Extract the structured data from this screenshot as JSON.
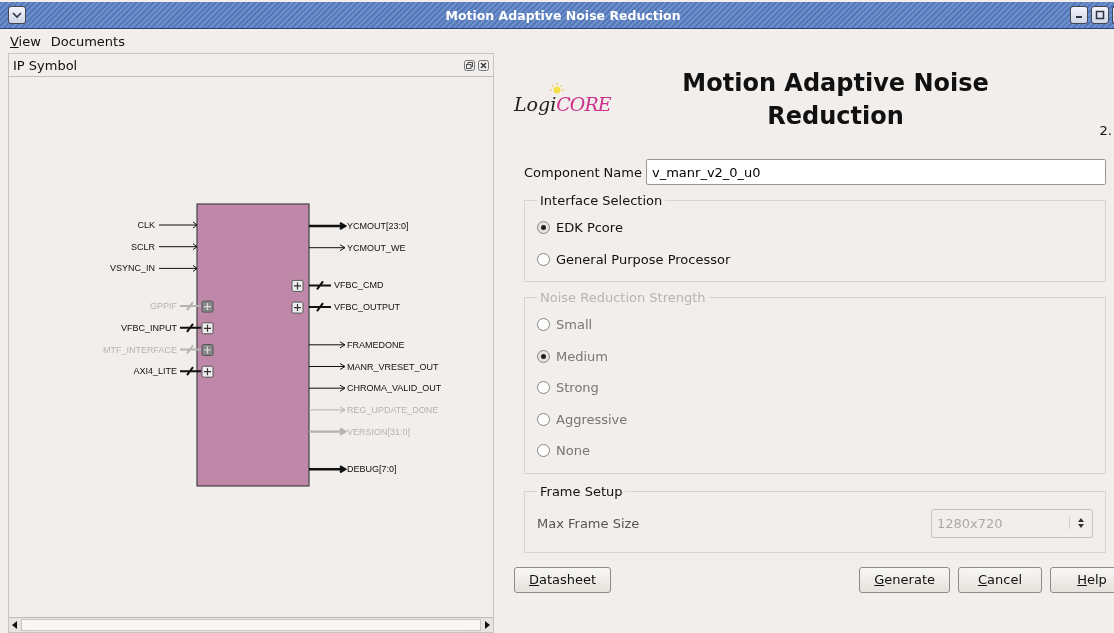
{
  "window": {
    "title": "Motion Adaptive Noise Reduction"
  },
  "menu": [
    {
      "label": "View",
      "underline_first": true
    },
    {
      "label": "Documents",
      "underline_first": false
    }
  ],
  "symbol_panel": {
    "title": "IP Symbol",
    "left_pin_groups": [
      [
        {
          "name": "CLK",
          "kind": "single",
          "enabled": true
        },
        {
          "name": "SCLR",
          "kind": "single",
          "enabled": true
        },
        {
          "name": "VSYNC_IN",
          "kind": "single",
          "enabled": true
        }
      ],
      [
        {
          "name": "GPPIF",
          "kind": "interface",
          "enabled": false
        },
        {
          "name": "VFBC_INPUT",
          "kind": "interface",
          "enabled": true
        },
        {
          "name": "MTF_INTERFACE",
          "kind": "interface",
          "enabled": false
        },
        {
          "name": "AXI4_LITE",
          "kind": "interface",
          "enabled": true
        }
      ]
    ],
    "right_pin_groups": [
      [
        {
          "name": "YCMOUT[23:0]",
          "kind": "bus",
          "enabled": true
        },
        {
          "name": "YCMOUT_WE",
          "kind": "single",
          "enabled": true
        }
      ],
      [
        {
          "name": "VFBC_CMD",
          "kind": "interface",
          "enabled": true
        },
        {
          "name": "VFBC_OUTPUT",
          "kind": "interface",
          "enabled": true
        }
      ],
      [
        {
          "name": "FRAMEDONE",
          "kind": "single",
          "enabled": true
        },
        {
          "name": "MANR_VRESET_OUT",
          "kind": "single",
          "enabled": true
        },
        {
          "name": "CHROMA_VALID_OUT",
          "kind": "single",
          "enabled": true
        },
        {
          "name": "REG_UPDATE_DONE",
          "kind": "single",
          "enabled": false
        },
        {
          "name": "VERSION[31:0]",
          "kind": "bus",
          "enabled": false
        }
      ],
      [
        {
          "name": "DEBUG[7:0]",
          "kind": "bus",
          "enabled": true
        }
      ]
    ]
  },
  "logo": {
    "left": "Logi",
    "right": "CORE"
  },
  "heading": "Motion Adaptive Noise Reduction",
  "version": "2.",
  "component_name": {
    "label": "Component Name",
    "value": "v_manr_v2_0_u0"
  },
  "groups": [
    {
      "title": "Interface Selection",
      "disabled": false,
      "options": [
        {
          "label": "EDK Pcore",
          "selected": true
        },
        {
          "label": "General Purpose Processor",
          "selected": false
        }
      ]
    },
    {
      "title": "Noise Reduction Strength",
      "disabled": true,
      "options": [
        {
          "label": "Small",
          "selected": false
        },
        {
          "label": "Medium",
          "selected": true
        },
        {
          "label": "Strong",
          "selected": false
        },
        {
          "label": "Aggressive",
          "selected": false
        },
        {
          "label": "None",
          "selected": false
        }
      ]
    }
  ],
  "frame_setup": {
    "title": "Frame Setup",
    "label": "Max Frame Size",
    "value": "1280x720",
    "disabled": true
  },
  "buttons": [
    {
      "label": "Datasheet",
      "underline_first": true
    },
    {
      "label": "Generate",
      "underline_first": true
    },
    {
      "label": "Cancel",
      "underline_first": true
    },
    {
      "label": "Help",
      "underline_first": true
    }
  ]
}
